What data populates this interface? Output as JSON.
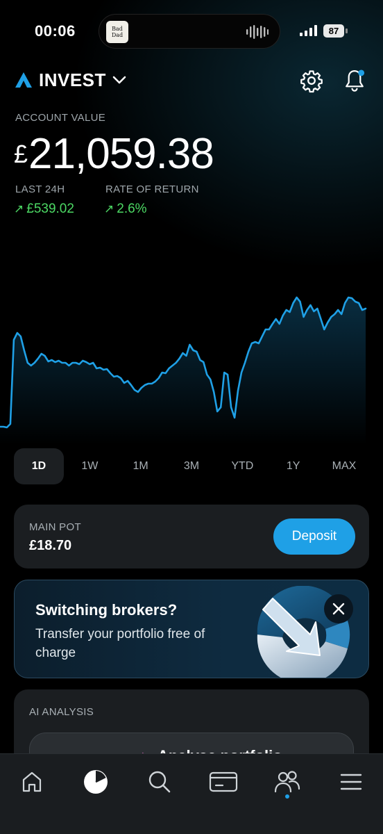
{
  "status": {
    "time": "00:06",
    "now_playing_art": "Bad Dad",
    "battery": "87"
  },
  "header": {
    "title": "INVEST",
    "logo_icon": "arrow-logo-icon",
    "settings_icon": "gear-icon",
    "notifications_icon": "bell-icon"
  },
  "account": {
    "label": "ACCOUNT VALUE",
    "currency": "£",
    "value": "21,059.38",
    "last24_label": "LAST 24H",
    "last24_value": "£539.02",
    "return_label": "RATE OF RETURN",
    "return_value": "2.6%",
    "arrow": "↗",
    "positive_color": "#4cd964"
  },
  "chart_data": {
    "type": "area",
    "title": "",
    "xlabel": "",
    "ylabel": "",
    "color": "#1fa0e6",
    "grid": false,
    "y": [
      20,
      20,
      19,
      24,
      145,
      155,
      150,
      130,
      112,
      108,
      112,
      118,
      125,
      122,
      114,
      116,
      113,
      115,
      112,
      112,
      108,
      112,
      112,
      110,
      115,
      113,
      110,
      112,
      104,
      105,
      102,
      103,
      97,
      92,
      93,
      90,
      83,
      86,
      80,
      73,
      70,
      76,
      80,
      82,
      82,
      85,
      90,
      98,
      97,
      104,
      108,
      112,
      118,
      126,
      122,
      138,
      130,
      128,
      116,
      113,
      95,
      88,
      70,
      42,
      48,
      98,
      95,
      48,
      33,
      72,
      98,
      112,
      128,
      140,
      142,
      140,
      150,
      160,
      160,
      168,
      175,
      168,
      180,
      188,
      185,
      198,
      206,
      200,
      178,
      188,
      195,
      186,
      190,
      175,
      160,
      170,
      178,
      182,
      188,
      182,
      198,
      206,
      205,
      200,
      198,
      188,
      190
    ]
  },
  "ranges": [
    "1D",
    "1W",
    "1M",
    "3M",
    "YTD",
    "1Y",
    "MAX"
  ],
  "active_range": "1D",
  "pot": {
    "label": "MAIN POT",
    "value": "£18.70",
    "deposit": "Deposit",
    "accent": "#1fa0e6"
  },
  "promo": {
    "title": "Switching brokers?",
    "subtitle": "Transfer your portfolio free of charge",
    "close_icon": "close-icon"
  },
  "ai": {
    "label": "AI ANALYSIS",
    "button": "Analyse portfolio"
  },
  "tabbar": {
    "items": [
      "home-icon",
      "portfolio-pie-icon",
      "search-icon",
      "card-icon",
      "community-icon",
      "menu-icon"
    ],
    "active": "portfolio-pie-icon"
  }
}
